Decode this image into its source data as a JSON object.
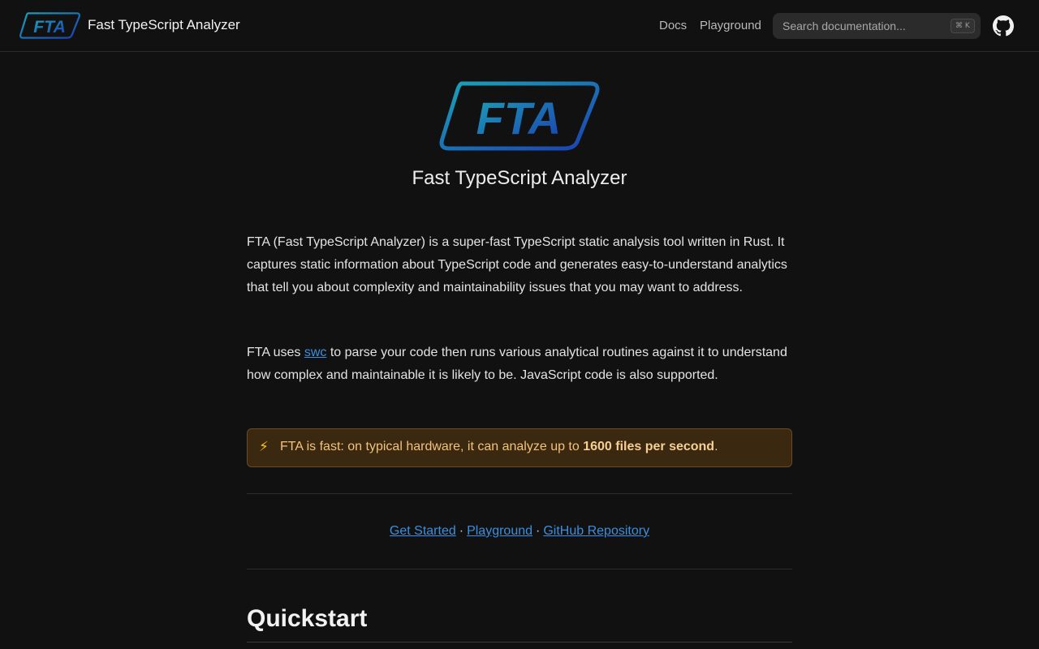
{
  "header": {
    "logo_text": "FTA",
    "title": "Fast TypeScript Analyzer",
    "nav": [
      {
        "label": "Docs"
      },
      {
        "label": "Playground"
      }
    ],
    "search": {
      "placeholder": "Search documentation...",
      "shortcut": "⌘ K"
    },
    "github_icon": "github-icon"
  },
  "hero": {
    "logo_text": "FTA",
    "title": "Fast TypeScript Analyzer"
  },
  "content": {
    "para1": "FTA (Fast TypeScript Analyzer) is a super-fast TypeScript static analysis tool written in Rust. It captures static information about TypeScript code and generates easy-to-understand analytics that tell you about complexity and maintainability issues that you may want to address.",
    "para2_before": "FTA uses ",
    "para2_link": "swc",
    "para2_after": " to parse your code then runs various analytical routines against it to understand how complex and maintainable it is likely to be. JavaScript code is also supported.",
    "callout": {
      "icon": "⚡",
      "text_before": "FTA is fast: on typical hardware, it can analyze up to ",
      "bold": "1600 files per second",
      "text_after": "."
    },
    "links": [
      {
        "label": "Get Started"
      },
      {
        "label": "Playground"
      },
      {
        "label": "GitHub Repository"
      }
    ],
    "separator": "·",
    "section_heading": "Quickstart"
  },
  "colors": {
    "background": "#111111",
    "link": "#3b8fe0",
    "logo_gradient_start": "#1aa3b8",
    "logo_gradient_end": "#1d3fb0",
    "callout_bg": "#3a2810",
    "callout_text": "#f3c27a"
  }
}
